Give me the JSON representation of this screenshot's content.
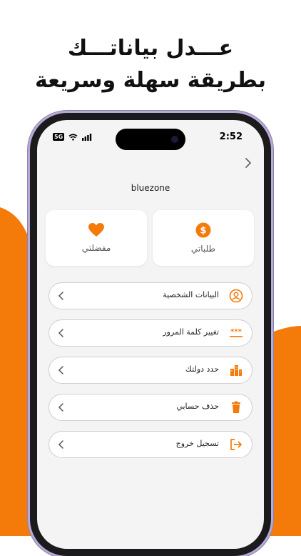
{
  "headline": {
    "line1": "عـــدل بياناتـــك",
    "line2": "بطريقة سهلة وسريعة"
  },
  "status_bar": {
    "time": "2:52",
    "network_badge": "5G"
  },
  "profile": {
    "username": "bluezone"
  },
  "cards": {
    "orders_label": "طلباتي",
    "orders_icon": "dollar-coin-icon",
    "favorites_label": "مفضلتي",
    "favorites_icon": "heart-icon"
  },
  "menu": {
    "items": [
      {
        "label": "البيانات الشخصية",
        "icon": "person-circle-icon"
      },
      {
        "label": "تغيير كلمة المرور",
        "icon": "password-asterisks-icon"
      },
      {
        "label": "حدد دولتك",
        "icon": "city-buildings-icon"
      },
      {
        "label": "حذف حسابي",
        "icon": "trash-icon"
      },
      {
        "label": "تسجيل خروج",
        "icon": "logout-icon"
      }
    ]
  },
  "colors": {
    "accent": "#F47A0A",
    "screen_bg": "#F4F4F4",
    "frame": "#1B1B1D",
    "frame_edge": "#B7A9D6"
  }
}
